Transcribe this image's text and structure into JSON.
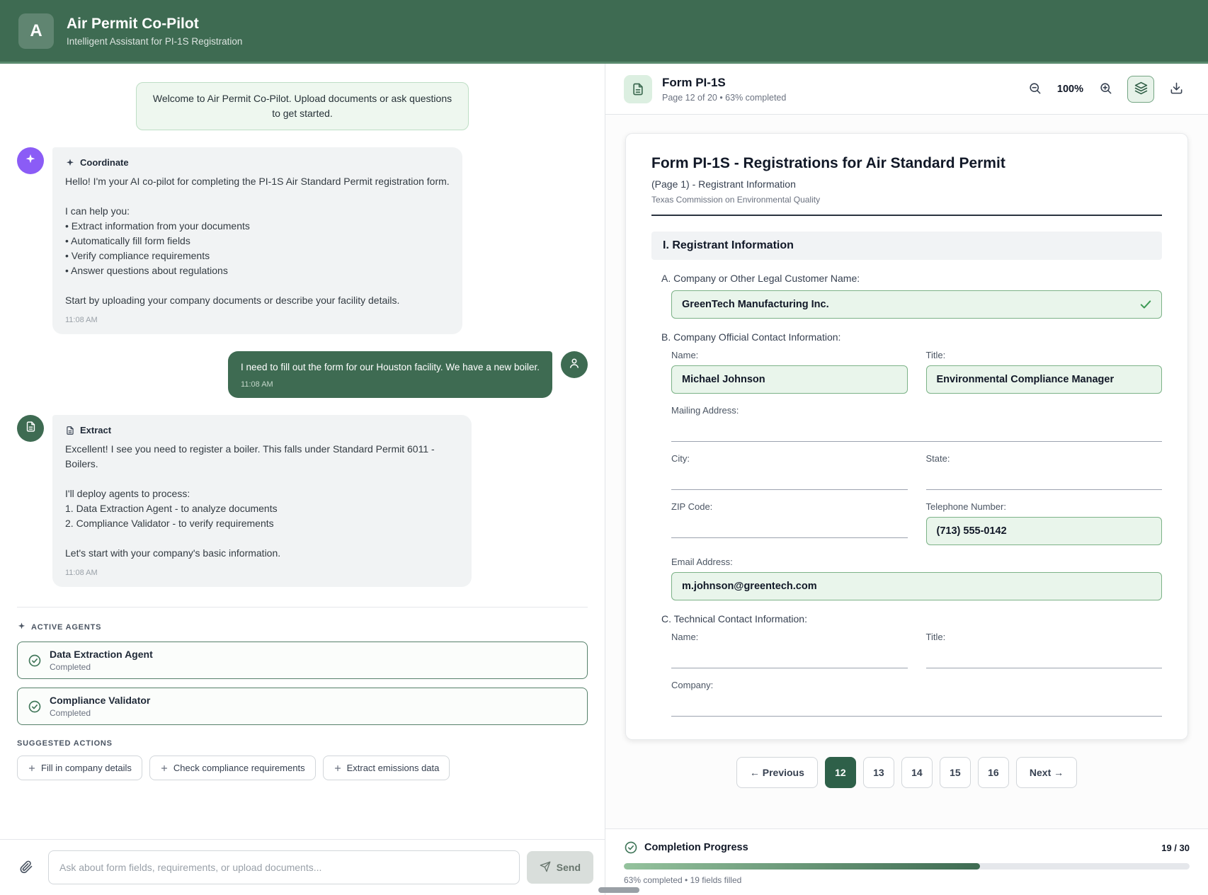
{
  "colors": {
    "brand_green": "#3e6b52",
    "agent_purple": "#8b5cf6",
    "filled_field_bg": "#e9f5eb",
    "filled_field_border": "#7cb287",
    "active_page_bg": "#2e6049",
    "progress_fill": "#3e6b52"
  },
  "header": {
    "logo": "A",
    "title": "Air Permit Co-Pilot",
    "subtitle": "Intelligent Assistant for PI-1S Registration"
  },
  "chat": {
    "welcome": "Welcome to Air Permit Co-Pilot. Upload documents or ask questions to get started.",
    "messages": [
      {
        "agent": "Coordinate",
        "time": "11:08 AM",
        "text": [
          "Hello! I'm your AI co-pilot for completing the PI-1S Air Standard Permit registration form.",
          "",
          "I can help you:",
          "• Extract information from your documents",
          "• Automatically fill form fields",
          "• Verify compliance requirements",
          "• Answer questions about regulations",
          "",
          "Start by uploading your company documents or describe your facility details."
        ]
      },
      {
        "agent": "user",
        "time": "11:08 AM",
        "text": [
          "I need to fill out the form for our Houston facility. We have a new boiler."
        ]
      },
      {
        "agent": "Extract",
        "time": "11:08 AM",
        "text": [
          "Excellent! I see you need to register a boiler. This falls under Standard Permit 6011 - Boilers.",
          "",
          "I'll deploy agents to process:",
          "1. Data Extraction Agent - to analyze documents",
          "2. Compliance Validator - to verify requirements",
          "",
          "Let's start with your company's basic information."
        ]
      }
    ],
    "active_agents": {
      "heading": "ACTIVE AGENTS",
      "items": [
        {
          "name": "Data Extraction Agent",
          "status": "Completed"
        },
        {
          "name": "Compliance Validator",
          "status": "Completed"
        }
      ]
    },
    "suggested_actions": {
      "heading": "SUGGESTED ACTIONS",
      "items": [
        "Fill in company details",
        "Check compliance requirements",
        "Extract emissions data"
      ]
    },
    "composer": {
      "placeholder": "Ask about form fields, requirements, or upload documents...",
      "send_label": "Send"
    }
  },
  "viewer": {
    "toolbar": {
      "title": "Form PI-1S",
      "subtitle": "Page 12 of 20 • 63% completed",
      "zoom": "100%"
    },
    "form": {
      "title": "Form PI-1S - Registrations for Air Standard Permit",
      "subtitle": "(Page 1) - Registrant Information",
      "agency": "Texas Commission on Environmental Quality",
      "section": "I. Registrant Information",
      "field_a": {
        "label": "A. Company or Other Legal Customer Name:",
        "value": "GreenTech Manufacturing Inc."
      },
      "field_b": {
        "label": "B. Company Official Contact Information:",
        "name": {
          "label": "Name:",
          "value": "Michael Johnson"
        },
        "title": {
          "label": "Title:",
          "value": "Environmental Compliance Manager"
        },
        "mailing": {
          "label": "Mailing Address:",
          "value": ""
        },
        "city": {
          "label": "City:",
          "value": ""
        },
        "state": {
          "label": "State:",
          "value": ""
        },
        "zip": {
          "label": "ZIP Code:",
          "value": ""
        },
        "phone": {
          "label": "Telephone Number:",
          "value": "(713) 555-0142"
        },
        "email": {
          "label": "Email Address:",
          "value": "m.johnson@greentech.com"
        }
      },
      "field_c": {
        "label": "C. Technical Contact Information:",
        "name": {
          "label": "Name:",
          "value": ""
        },
        "title": {
          "label": "Title:",
          "value": ""
        },
        "company": {
          "label": "Company:",
          "value": ""
        }
      }
    },
    "pagination": {
      "prev": "← Previous",
      "pages": [
        "12",
        "13",
        "14",
        "15",
        "16"
      ],
      "active": "12",
      "next": "Next →"
    },
    "progress": {
      "title": "Completion Progress",
      "fraction": "19 / 30",
      "percent": 63,
      "caption": "63% completed • 19 fields filled"
    }
  }
}
